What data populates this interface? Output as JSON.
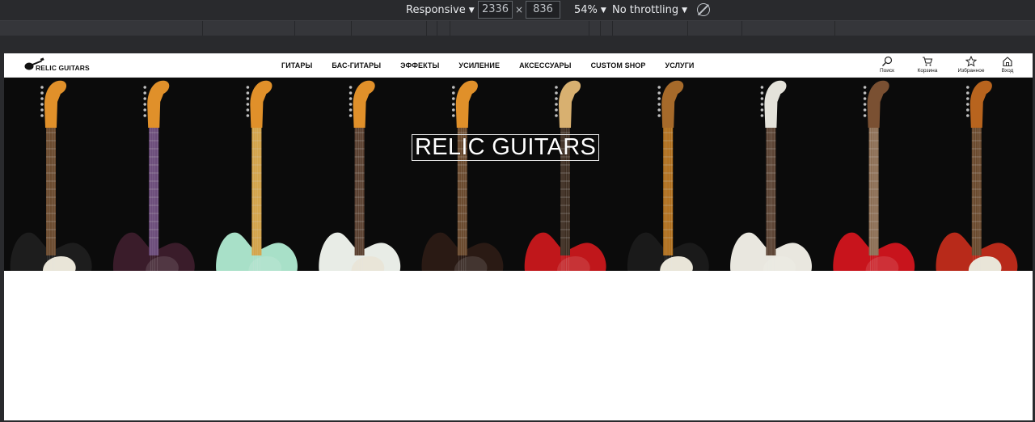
{
  "devtools": {
    "device_mode": "Responsive",
    "width_value": "2336",
    "height_value": "836",
    "times_sign": "×",
    "zoom": "54%",
    "throttling": "No throttling"
  },
  "site": {
    "logo_text": "RELIC GUITARS",
    "nav": [
      {
        "label": "ГИТАРЫ"
      },
      {
        "label": "БАС-ГИТАРЫ"
      },
      {
        "label": "ЭФФЕКТЫ"
      },
      {
        "label": "УСИЛЕНИЕ"
      },
      {
        "label": "АКСЕССУАРЫ"
      },
      {
        "label": "CUSTOM SHOP"
      },
      {
        "label": "УСЛУГИ"
      }
    ],
    "actions": [
      {
        "label": "Поиск",
        "icon": "search-icon"
      },
      {
        "label": "Корзина",
        "icon": "cart-icon"
      },
      {
        "label": "Избранное",
        "icon": "star-icon"
      },
      {
        "label": "Вход",
        "icon": "home-icon"
      }
    ],
    "hero_title": "RELIC GUITARS"
  },
  "colors": {
    "devtools_bg": "#292a2d",
    "hero_bg": "#0b0b0b",
    "guitar_bodies": [
      "#1d1d1d",
      "#3a1c2a",
      "#a8e0c8",
      "#e8ece6",
      "#2a1a14",
      "#c0171b",
      "#1a1a1a",
      "#e9e7df",
      "#c8141c",
      "#b82a1a"
    ],
    "headstock_amber": "#e0902a"
  }
}
